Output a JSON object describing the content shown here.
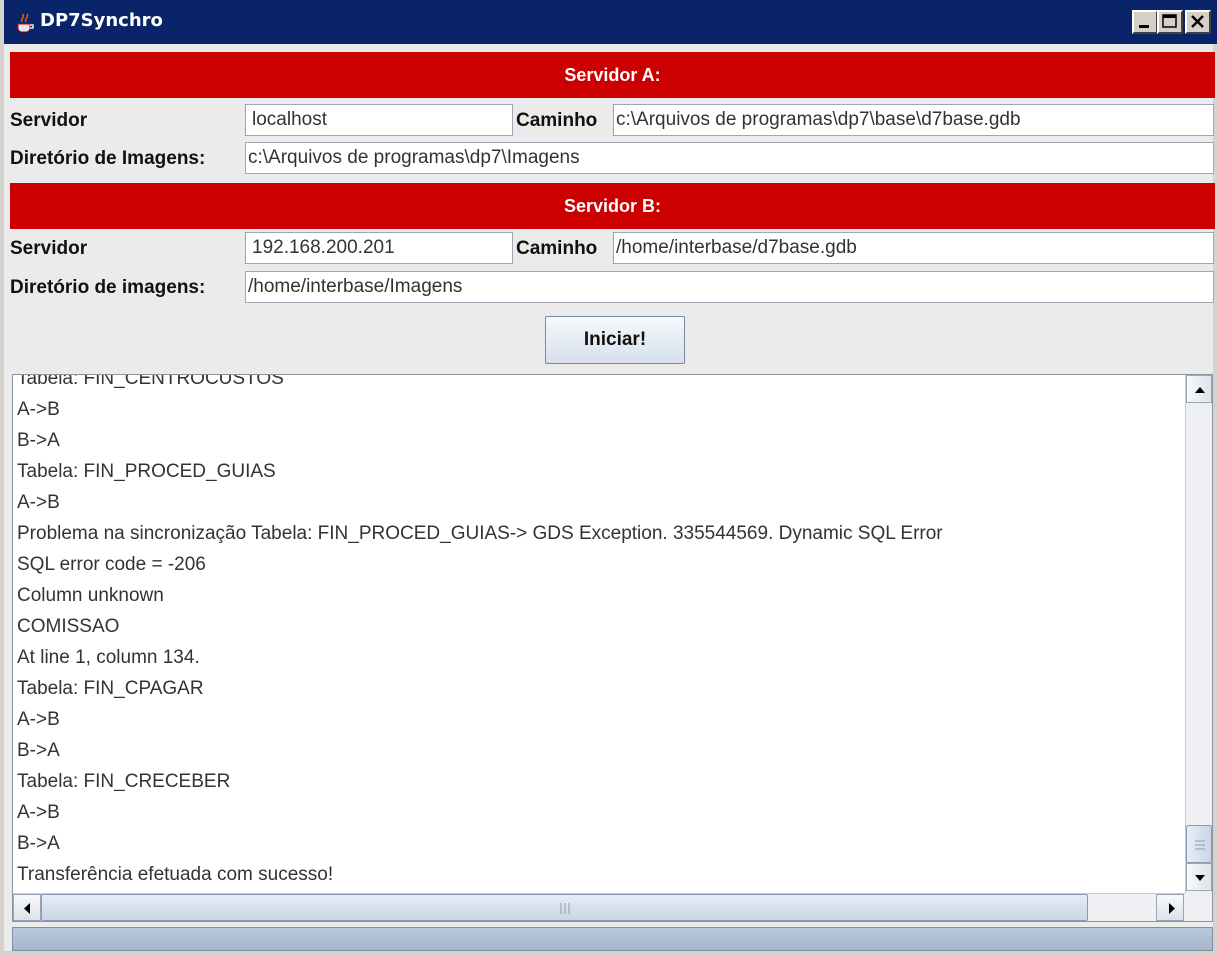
{
  "window": {
    "title": "DP7Synchro",
    "icon": "java-cup-icon",
    "colors": {
      "titlebar": "#0a246a",
      "section_header": "#cc0000"
    }
  },
  "server_a": {
    "header": "Servidor A:",
    "server_label": "Servidor",
    "server_value": "localhost",
    "path_label": "Caminho",
    "path_value": "c:\\Arquivos de programas\\dp7\\base\\d7base.gdb",
    "images_label": "Diretório de Imagens:",
    "images_value": "c:\\Arquivos de programas\\dp7\\Imagens"
  },
  "server_b": {
    "header": "Servidor B:",
    "server_label": "Servidor",
    "server_value": "192.168.200.201",
    "path_label": "Caminho",
    "path_value": "/home/interbase/d7base.gdb",
    "images_label": "Diretório de imagens:",
    "images_value": "/home/interbase/Imagens"
  },
  "actions": {
    "start_label": "Iniciar!"
  },
  "log": {
    "lines": [
      "Tabela: FIN_CENTROCUSTOS",
      "A->B",
      "B->A",
      "Tabela: FIN_PROCED_GUIAS",
      "A->B",
      "Problema na sincronização Tabela: FIN_PROCED_GUIAS-> GDS Exception. 335544569. Dynamic SQL Error",
      "SQL error code = -206",
      "Column unknown",
      "COMISSAO",
      "At line 1, column 134.",
      "Tabela: FIN_CPAGAR",
      "A->B",
      "B->A",
      "Tabela: FIN_CRECEBER",
      "A->B",
      "B->A",
      "Transferência efetuada com sucesso!"
    ]
  }
}
